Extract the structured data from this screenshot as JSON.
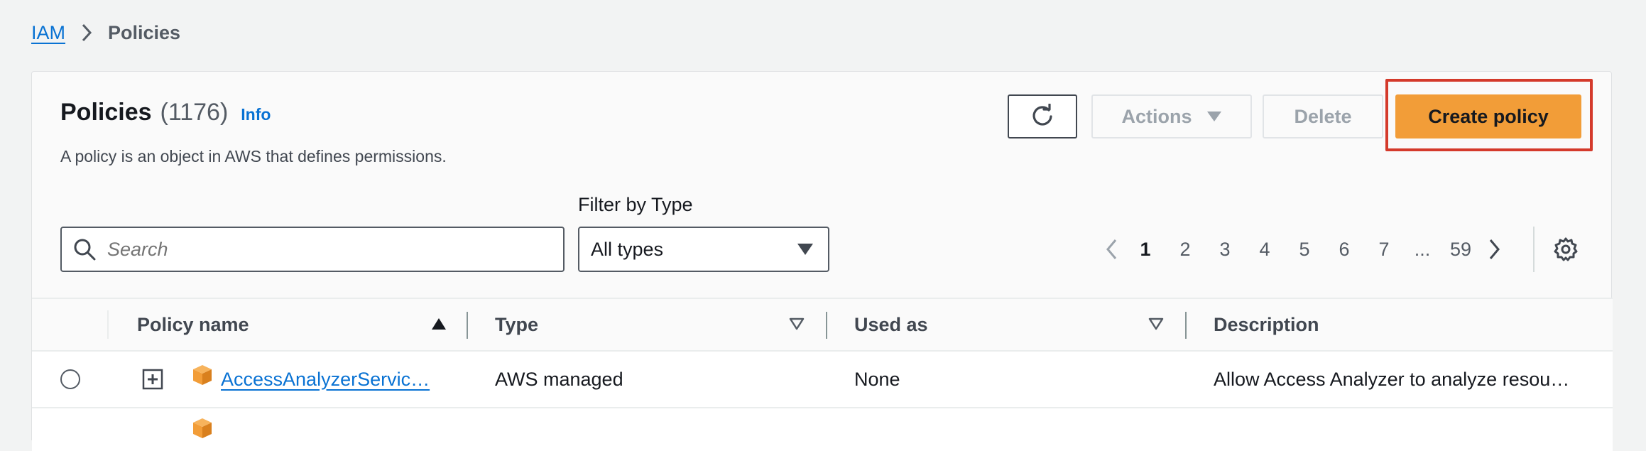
{
  "breadcrumb": {
    "root": "IAM",
    "current": "Policies"
  },
  "header": {
    "title": "Policies",
    "count": "(1176)",
    "info": "Info",
    "subtitle": "A policy is an object in AWS that defines permissions.",
    "actions_label": "Actions",
    "delete_label": "Delete",
    "create_label": "Create policy"
  },
  "filters": {
    "search_placeholder": "Search",
    "type_label": "Filter by Type",
    "type_value": "All types"
  },
  "pagination": {
    "pages": [
      "1",
      "2",
      "3",
      "4",
      "5",
      "6",
      "7"
    ],
    "ellipsis": "...",
    "last": "59",
    "current": "1"
  },
  "table": {
    "columns": {
      "name": "Policy name",
      "type": "Type",
      "used_as": "Used as",
      "description": "Description"
    },
    "rows": [
      {
        "name": "AccessAnalyzerServic…",
        "type": "AWS managed",
        "used_as": "None",
        "description": "Allow Access Analyzer to analyze resou…"
      }
    ]
  },
  "colors": {
    "primary_button": "#f29d38",
    "link": "#0972d3",
    "highlight": "#d43a2b",
    "aws_icon": "#f29d38"
  },
  "icons": {
    "refresh": "refresh-icon",
    "search": "search-icon",
    "settings": "gear-icon",
    "aws_managed": "aws-cube-icon",
    "expand": "plus-square-icon"
  }
}
